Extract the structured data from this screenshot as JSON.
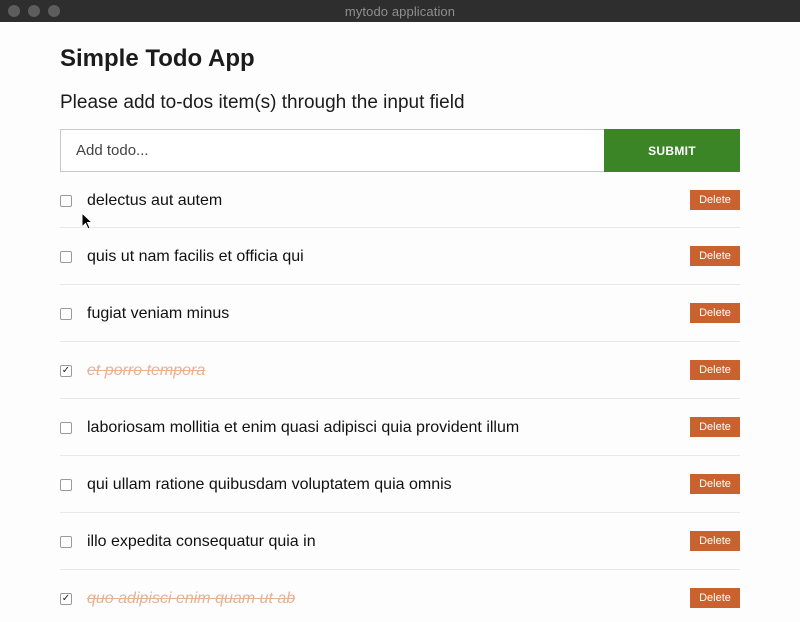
{
  "window": {
    "title": "mytodo application"
  },
  "app": {
    "title": "Simple Todo App",
    "subtitle": "Please add to-dos item(s) through the input field"
  },
  "form": {
    "input_placeholder": "Add todo...",
    "input_value": "",
    "submit_label": "SUBMIT"
  },
  "todos": [
    {
      "text": "delectus aut autem",
      "completed": false,
      "delete_label": "Delete"
    },
    {
      "text": "quis ut nam facilis et officia qui",
      "completed": false,
      "delete_label": "Delete"
    },
    {
      "text": "fugiat veniam minus",
      "completed": false,
      "delete_label": "Delete"
    },
    {
      "text": "et porro tempora",
      "completed": true,
      "delete_label": "Delete"
    },
    {
      "text": "laboriosam mollitia et enim quasi adipisci quia provident illum",
      "completed": false,
      "delete_label": "Delete"
    },
    {
      "text": "qui ullam ratione quibusdam voluptatem quia omnis",
      "completed": false,
      "delete_label": "Delete"
    },
    {
      "text": "illo expedita consequatur quia in",
      "completed": false,
      "delete_label": "Delete"
    },
    {
      "text": "quo adipisci enim quam ut ab",
      "completed": true,
      "delete_label": "Delete"
    }
  ],
  "colors": {
    "submit_bg": "#3c8527",
    "delete_bg": "#c9622e",
    "completed_text": "#e7b193",
    "titlebar_bg": "#2e2e2e"
  },
  "icons": {
    "cursor": "mouse-pointer-icon",
    "check": "checkmark-icon"
  }
}
